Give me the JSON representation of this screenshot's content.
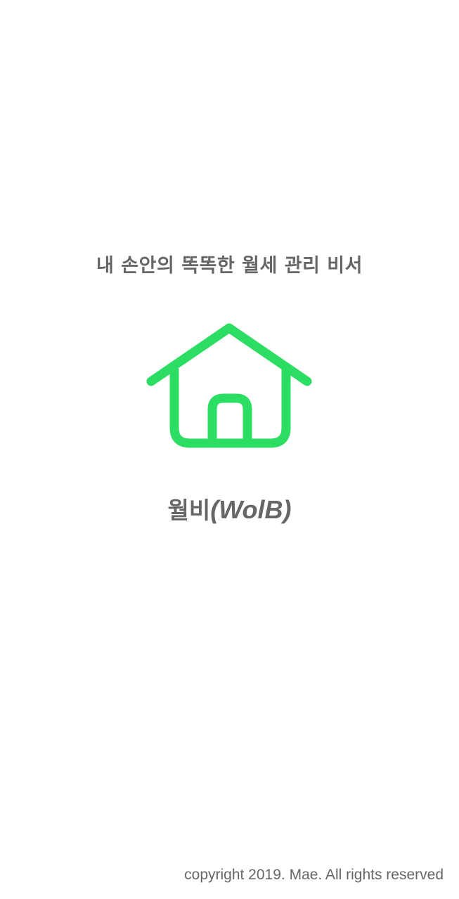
{
  "splash": {
    "tagline": "내 손안의 똑똑한 월세 관리 비서",
    "logo_icon": "house-icon",
    "app_name_korean": "월비",
    "app_name_latin": "(WolB)",
    "copyright": "copyright 2019. Mae. All rights reserved"
  },
  "colors": {
    "background": "#ffffff",
    "text": "#666666",
    "accent": "#2bde63"
  }
}
